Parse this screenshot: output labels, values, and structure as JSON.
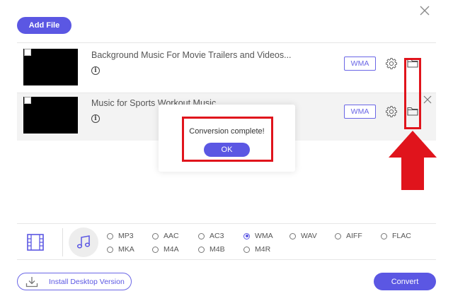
{
  "toolbar": {
    "add_file_label": "Add File"
  },
  "files": [
    {
      "name": "Background Music For Movie Trailers and Videos...",
      "format": "WMA"
    },
    {
      "name": "Music for Sports Workout Music",
      "format": "WMA"
    }
  ],
  "dialog": {
    "message": "Conversion complete!",
    "ok_label": "OK"
  },
  "formats": {
    "options": [
      "MP3",
      "AAC",
      "AC3",
      "WMA",
      "WAV",
      "AIFF",
      "FLAC",
      "MKA",
      "M4A",
      "M4B",
      "M4R"
    ],
    "selected": "WMA"
  },
  "footer": {
    "install_label": "Install Desktop Version",
    "convert_label": "Convert"
  },
  "colors": {
    "accent": "#5b57e3",
    "highlight": "#e0141c"
  }
}
